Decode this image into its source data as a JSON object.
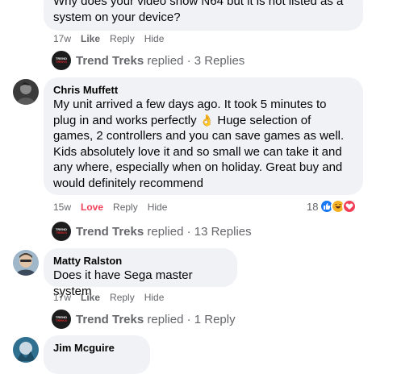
{
  "comments": [
    {
      "body_lines": [
        "Why does your video show N64 but it is not listed as a",
        "system on your device?"
      ],
      "time": "17w",
      "like": "Like",
      "reply": "Reply",
      "hide": "Hide",
      "replies_summary": {
        "name": "Trend Treks",
        "text": "replied · 3 Replies"
      }
    },
    {
      "author": "Chris Muffett",
      "body_lines": [
        "My unit arrived a few days ago. It took 5 minutes to",
        "plug in and works perfectly",
        "games, 2 controllers and you can save games as well.",
        "Kids absolutely love it and so small we can take it and",
        "any where, especially when on holiday. Great buy and",
        "would definitely recommend"
      ],
      "line2_tail": "Huge selection of",
      "emoji": "👌",
      "time": "15w",
      "reaction_label": "Love",
      "reply": "Reply",
      "hide": "Hide",
      "reaction_count": "18",
      "replies_summary": {
        "name": "Trend Treks",
        "text": "replied · 13 Replies"
      }
    },
    {
      "author": "Matty Ralston",
      "body_lines": [
        "Does it have Sega master system"
      ],
      "time": "17w",
      "like": "Like",
      "reply": "Reply",
      "hide": "Hide",
      "replies_summary": {
        "name": "Trend Treks",
        "text": "replied · 1 Reply"
      }
    },
    {
      "author": "Jim Mcguire"
    }
  ],
  "page_logo": {
    "line1": "TREND",
    "line2": "TREKS"
  },
  "colors": {
    "bubble": "#f0f2f5",
    "secondary_text": "#65676b",
    "love": "#f33e58",
    "like_blue": "#1877f2"
  }
}
